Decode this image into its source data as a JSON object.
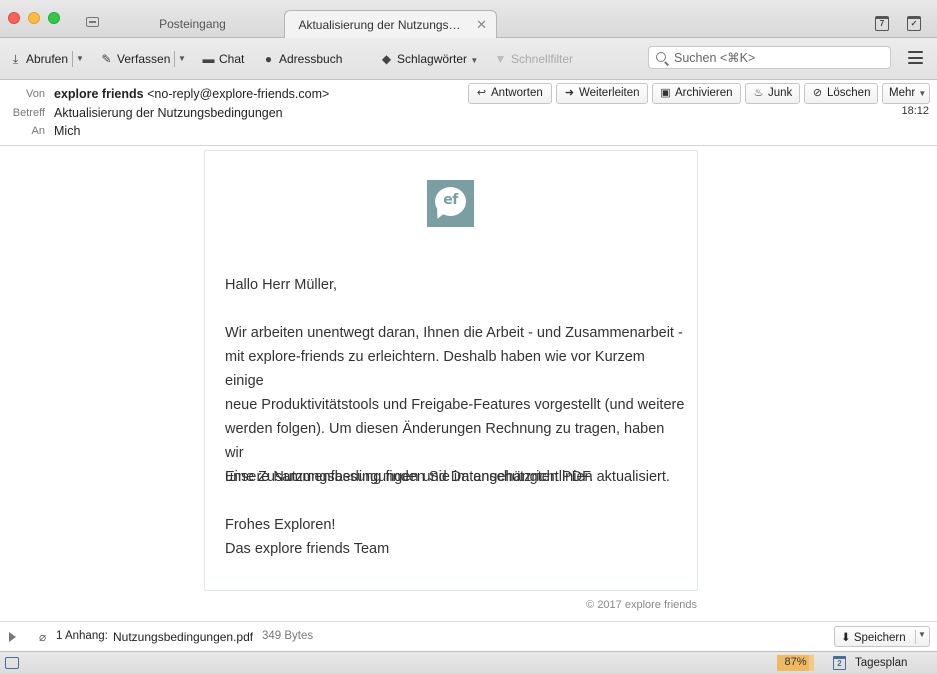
{
  "tabs": {
    "inbox": "Posteingang",
    "active": "Aktualisierung der Nutzungs…",
    "close": "✕",
    "calendar_day": "7"
  },
  "toolbar": {
    "get_mail": "Abrufen",
    "compose": "Verfassen",
    "chat": "Chat",
    "address_book": "Adressbuch",
    "tags": "Schlagwörter",
    "quick_filter": "Schnellfilter",
    "search_placeholder": "Suchen <⌘K>"
  },
  "header": {
    "from_label": "Von",
    "from_name": "explore friends",
    "from_email": "<no-reply@explore-friends.com>",
    "subject_label": "Betreff",
    "subject": "Aktualisierung der Nutzungsbedingungen",
    "to_label": "An",
    "to": "Mich",
    "time": "18:12",
    "actions": {
      "reply": "Antworten",
      "forward": "Weiterleiten",
      "archive": "Archivieren",
      "junk": "Junk",
      "delete": "Löschen",
      "more": "Mehr"
    }
  },
  "message": {
    "logo_text": "ef",
    "greeting": "Hallo Herr Müller,",
    "paragraph_lines": [
      "Wir arbeiten unentwegt daran, Ihnen die Arbeit - und Zusammenarbeit -",
      "mit explore-friends zu erleichtern. Deshalb haben wie vor Kurzem einige",
      "neue Produktivitätstools und Freigabe-Features vorgestellt (und weitere",
      "werden folgen). Um diesen Änderungen Rechnung zu tragen, haben wir",
      "unsere Nutzungsbedingungen und Datenschutzrichtlinien aktualisiert."
    ],
    "summary": "Eine Zusammenfassung finden Sie im angehängten PDF.",
    "closing": "Frohes Exploren!",
    "signature": "Das explore friends Team",
    "copyright": "© 2017 explore friends"
  },
  "attachment": {
    "count": "1 Anhang:",
    "filename": "Nutzungsbedingungen.pdf",
    "size": "349 Bytes",
    "save": "Speichern"
  },
  "status": {
    "progress_text": "87%",
    "progress_value": 0.87,
    "day_number": "2",
    "today_pane": "Tagesplan"
  }
}
